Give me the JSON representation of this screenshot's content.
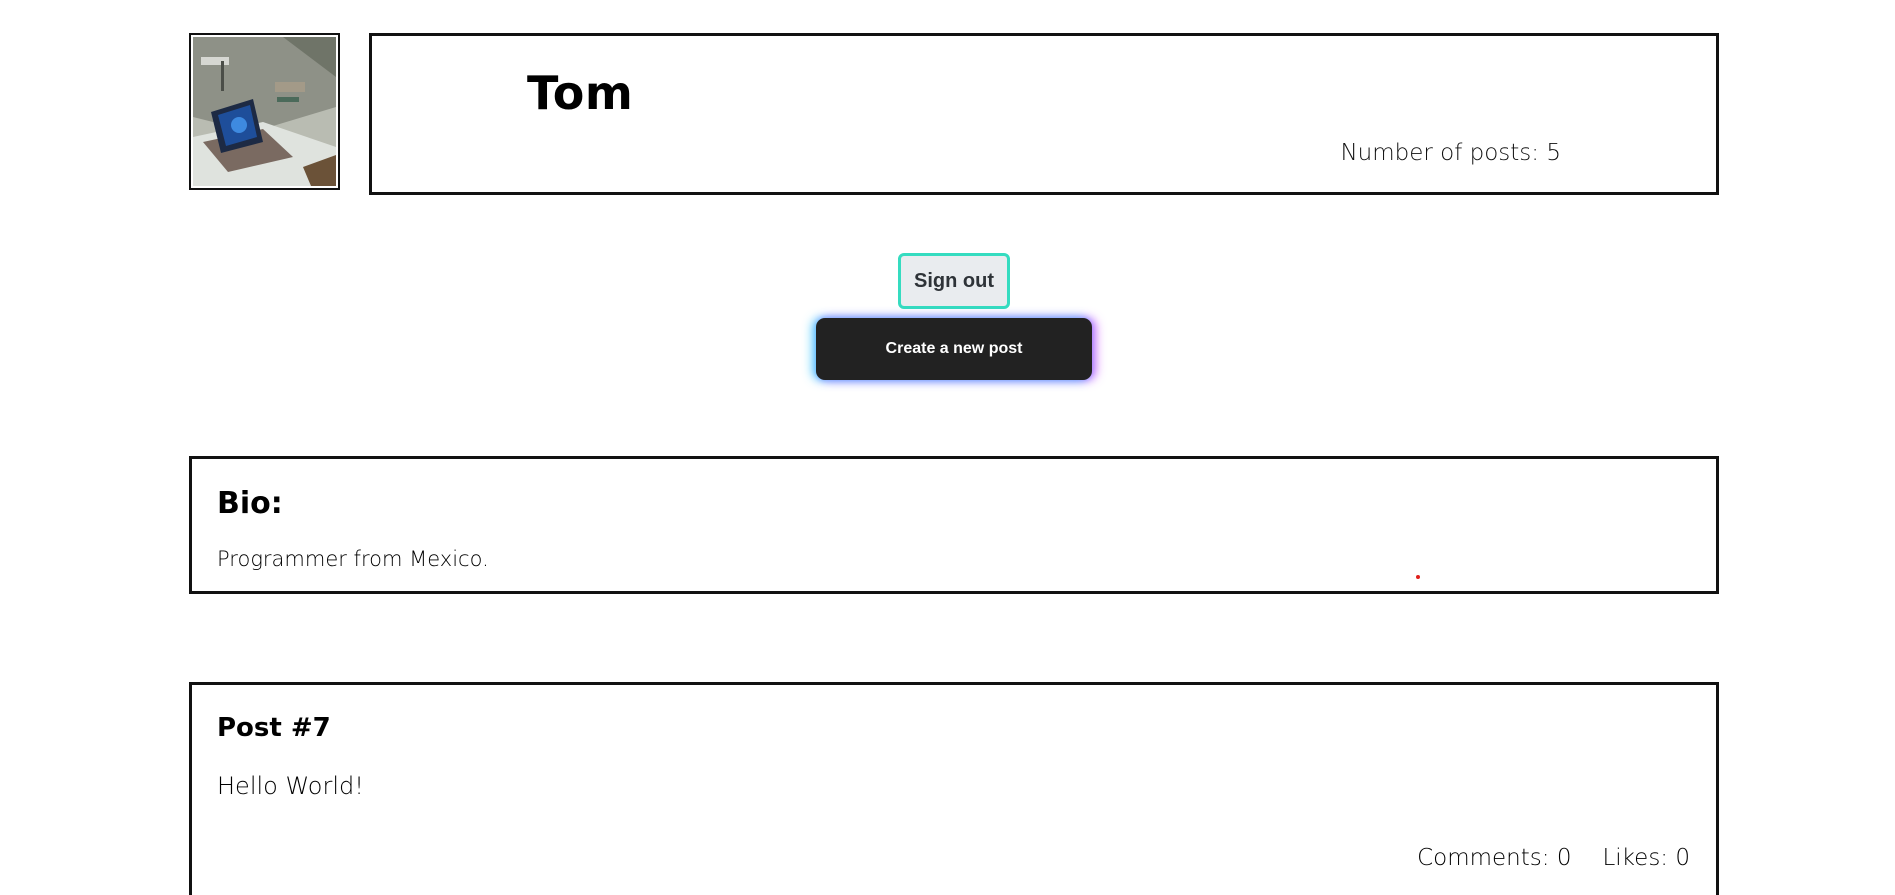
{
  "profile": {
    "avatar_icon": "profile-photo-laptop-on-desk",
    "name": "Tom",
    "post_count_text": "Number of posts: 5"
  },
  "actions": {
    "sign_out_label": "Sign out",
    "create_post_label": "Create a new post",
    "sign_out_border_color": "#35dcc0",
    "create_post_bg_color": "#222222"
  },
  "bio": {
    "heading": "Bio:",
    "text": "Programmer from Mexico."
  },
  "posts": [
    {
      "title": "Post #7",
      "body": "Hello World!",
      "comments_text": "Comments: 0",
      "likes_text": "Likes: 0"
    }
  ]
}
